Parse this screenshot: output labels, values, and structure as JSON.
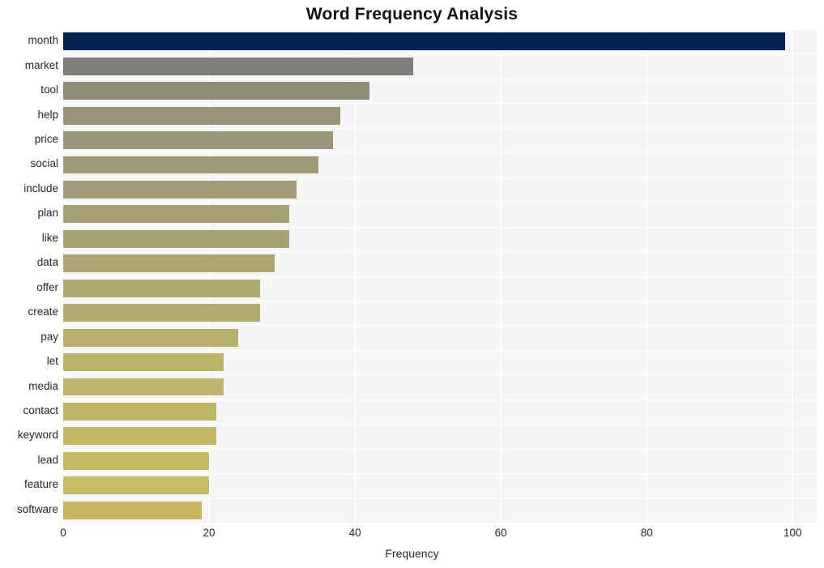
{
  "chart_data": {
    "type": "bar",
    "orientation": "horizontal",
    "title": "Word Frequency Analysis",
    "xlabel": "Frequency",
    "ylabel": "",
    "xlim": [
      0,
      103.3
    ],
    "xticks": [
      0,
      20,
      40,
      60,
      80,
      100
    ],
    "xtick_labels": [
      "0",
      "20",
      "40",
      "60",
      "80",
      "100"
    ],
    "grid": true,
    "grid_color": "#ffffff",
    "plot_background": "#f5f5f6",
    "legend": null,
    "categories": [
      "month",
      "market",
      "tool",
      "help",
      "price",
      "social",
      "include",
      "plan",
      "like",
      "data",
      "offer",
      "create",
      "pay",
      "let",
      "media",
      "contact",
      "keyword",
      "lead",
      "feature",
      "software"
    ],
    "values": [
      99,
      48,
      42,
      38,
      37,
      35,
      32,
      31,
      31,
      29,
      27,
      27,
      24,
      22,
      22,
      21,
      21,
      20,
      20,
      19
    ],
    "bar_colors": [
      "#042554",
      "#7f7e7a",
      "#8f8d76",
      "#97947a",
      "#9a9679",
      "#9e9a78",
      "#a39d78",
      "#a5a077",
      "#a7a276",
      "#aaa574",
      "#b0aa71",
      "#b2ac70",
      "#b7b06d",
      "#bab36b",
      "#bcb56a",
      "#bfb768",
      "#c1b967",
      "#c3bb65",
      "#c5bd64",
      "#c7b563"
    ]
  }
}
